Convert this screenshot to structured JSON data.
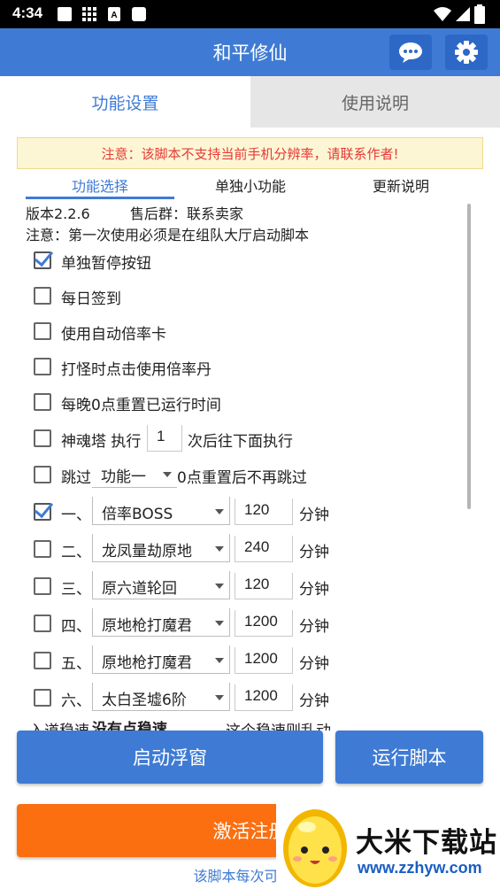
{
  "status_bar": {
    "time": "4:34"
  },
  "app_bar": {
    "title": "和平修仙",
    "chat_icon": "chat-bubble-icon",
    "settings_icon": "gear-icon"
  },
  "main_tabs": [
    {
      "label": "功能设置",
      "active": true
    },
    {
      "label": "使用说明",
      "active": false
    }
  ],
  "notice": "注意：该脚本不支持当前手机分辨率，请联系作者!",
  "sub_tabs": [
    {
      "label": "功能选择",
      "active": true
    },
    {
      "label": "单独小功能",
      "active": false
    },
    {
      "label": "更新说明",
      "active": false
    }
  ],
  "info": {
    "version": "版本2.2.6",
    "group": "售后群：联系卖家",
    "warning": "注意：第一次使用必须是在组队大厅启动脚本"
  },
  "options": [
    {
      "label": "单独暂停按钮",
      "checked": true
    },
    {
      "label": "每日签到",
      "checked": false
    },
    {
      "label": "使用自动倍率卡",
      "checked": false
    },
    {
      "label": "打怪时点击使用倍率丹",
      "checked": false
    },
    {
      "label": "每晚0点重置已运行时间",
      "checked": false
    }
  ],
  "tower": {
    "prefix": "神魂塔 执行",
    "value": "1",
    "suffix": "次后往下面执行",
    "checked": false
  },
  "skip": {
    "prefix": "跳过",
    "selected": "功能一",
    "suffix": "0点重置后不再跳过",
    "checked": false
  },
  "tasks": [
    {
      "index": "一、",
      "selected": "倍率BOSS",
      "minutes": "120",
      "unit": "分钟",
      "checked": true
    },
    {
      "index": "二、",
      "selected": "龙凤量劫原地",
      "minutes": "240",
      "unit": "分钟",
      "checked": false
    },
    {
      "index": "三、",
      "selected": "原六道轮回",
      "minutes": "120",
      "unit": "分钟",
      "checked": false
    },
    {
      "index": "四、",
      "selected": "原地枪打魔君",
      "minutes": "1200",
      "unit": "分钟",
      "checked": false
    },
    {
      "index": "五、",
      "selected": "原地枪打魔君",
      "minutes": "1200",
      "unit": "分钟",
      "checked": false
    },
    {
      "index": "六、",
      "selected": "太白圣墟6阶",
      "minutes": "1200",
      "unit": "分钟",
      "checked": false
    }
  ],
  "partial_row": {
    "prefix": "入道稳速",
    "selected": "没有点稳速",
    "suffix": "这个稳速则乱动"
  },
  "buttons": {
    "float_window": "启动浮窗",
    "run_script": "运行脚本",
    "activate": "激活注册"
  },
  "footer": "该脚本每次可以试",
  "watermark": {
    "text": "大米下载站",
    "url": "www.zzhyw.com"
  },
  "colors": {
    "primary": "#3f7bd4",
    "accent_orange": "#fb6f10",
    "notice_text": "#e53935",
    "notice_bg": "#fdf6d5"
  }
}
